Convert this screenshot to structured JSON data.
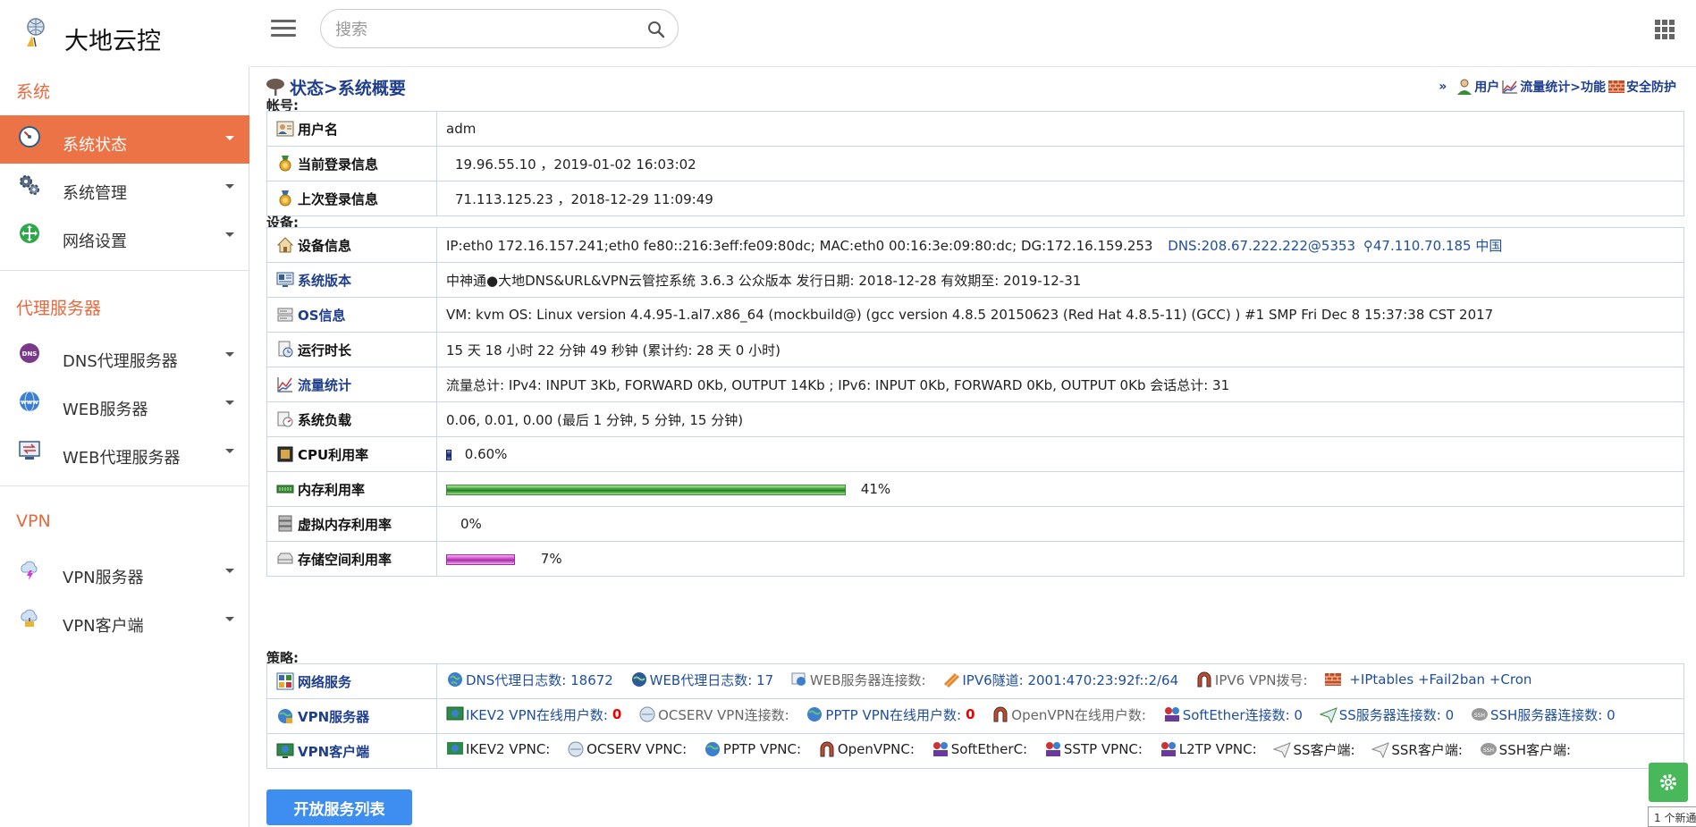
{
  "header": {
    "brand": "大地云控",
    "search_placeholder": "搜索"
  },
  "sidebar": {
    "sections": [
      {
        "title": "系统",
        "items": [
          {
            "label": "系统状态",
            "icon": "speedometer-icon",
            "active": true
          },
          {
            "label": "系统管理",
            "icon": "gears-icon"
          },
          {
            "label": "网络设置",
            "icon": "network-arrows-icon"
          }
        ]
      },
      {
        "title": "代理服务器",
        "items": [
          {
            "label": "DNS代理服务器",
            "icon": "dns-icon"
          },
          {
            "label": "WEB服务器",
            "icon": "www-globe-icon"
          },
          {
            "label": "WEB代理服务器",
            "icon": "proxy-transfer-icon"
          }
        ]
      },
      {
        "title": "VPN",
        "items": [
          {
            "label": "VPN服务器",
            "icon": "cloud-lightning-icon"
          },
          {
            "label": "VPN客户端",
            "icon": "cloud-client-icon"
          }
        ]
      }
    ]
  },
  "page": {
    "title": "状态>系统概要",
    "quick_links_prefix": "»",
    "quick_links": [
      "用户",
      "流量统计>功能",
      "安全防护"
    ]
  },
  "account": {
    "label": "帐号:",
    "rows": [
      {
        "key": "用户名",
        "value": "adm"
      },
      {
        "key": "当前登录信息",
        "value": "19.96.55.10 ，2019-01-02 16:03:02"
      },
      {
        "key": "上次登录信息",
        "value": "71.113.125.23 ，2018-12-29 11:09:49"
      }
    ]
  },
  "device": {
    "label": "设备:",
    "device_info": {
      "key": "设备信息",
      "text": "IP:eth0 172.16.157.241;eth0 fe80::216:3eff:fe09:80dc; MAC:eth0 00:16:3e:09:80:dc; DG:172.16.159.253",
      "dns": "DNS:208.67.222.222@5353",
      "location": "47.110.70.185 中国"
    },
    "version": {
      "key": "系统版本",
      "value": "中神通●大地DNS&URL&VPN云管控系统 3.6.3 公众版本   发行日期: 2018-12-28    有效期至: 2019-12-31"
    },
    "os": {
      "key": "OS信息",
      "value": "VM: kvm   OS: Linux version 4.4.95-1.al7.x86_64 (mockbuild@) (gcc version 4.8.5 20150623 (Red Hat 4.8.5-11) (GCC) ) #1 SMP Fri Dec 8 15:37:38 CST 2017"
    },
    "uptime": {
      "key": "运行时长",
      "value": "15 天 18 小时 22 分钟 49 秒钟 (累计约: 28 天 0 小时)"
    },
    "traffic": {
      "key": "流量统计",
      "value": "流量总计: IPv4: INPUT 3Kb, FORWARD 0Kb, OUTPUT 14Kb ; IPv6: INPUT 0Kb, FORWARD 0Kb, OUTPUT 0Kb    会话总计: 31"
    },
    "load": {
      "key": "系统负载",
      "value": "0.06, 0.01, 0.00 (最后 1 分钟, 5 分钟, 15 分钟)"
    },
    "cpu": {
      "key": "CPU利用率",
      "value": "0.60%",
      "percent": 0.6
    },
    "memory": {
      "key": "内存利用率",
      "value": "41%",
      "percent": 41
    },
    "swap": {
      "key": "虚拟内存利用率",
      "value": "0%",
      "percent": 0
    },
    "storage": {
      "key": "存储空间利用率",
      "value": "7%",
      "percent": 7
    }
  },
  "policy": {
    "label": "策略:",
    "network": {
      "key": "网络服务",
      "dns_log": "DNS代理日志数: 18672",
      "web_proxy_log": "WEB代理日志数: 17",
      "web_server_conn": "WEB服务器连接数:",
      "ipv6_tunnel": "IPV6隧道: 2001:470:23:92f::2/64",
      "ipv6_vpn": "IPV6 VPN拨号:",
      "iptables": "+IPtables +Fail2ban +Cron"
    },
    "vpn_server": {
      "key": "VPN服务器",
      "ikev2_label": "IKEV2 VPN在线用户数:",
      "ikev2_count": "0",
      "ocserv": "OCSERV VPN连接数:",
      "pptp_label": "PPTP VPN在线用户数:",
      "pptp_count": "0",
      "openvpn": "OpenVPN在线用户数:",
      "softether": "SoftEther连接数: 0",
      "ss": "SS服务器连接数: 0",
      "ssh": "SSH服务器连接数: 0"
    },
    "vpn_client": {
      "key": "VPN客户端",
      "items": [
        "IKEV2 VPNC:",
        "OCSERV VPNC:",
        "PPTP VPNC:",
        "OpenVPNC:",
        "SoftEtherC:",
        "SSTP VPNC:",
        "L2TP VPNC:",
        "SS客户端:",
        "SSR客户端:",
        "SSH客户端:"
      ]
    }
  },
  "actions": {
    "open_services": "开放服务列表"
  },
  "notice": {
    "text": "1 个新通"
  },
  "colors": {
    "accent": "#ec7346",
    "section_title": "#e8683d",
    "link": "#1f3f8c",
    "button": "#3e8ef2",
    "fab": "#48b85a"
  }
}
